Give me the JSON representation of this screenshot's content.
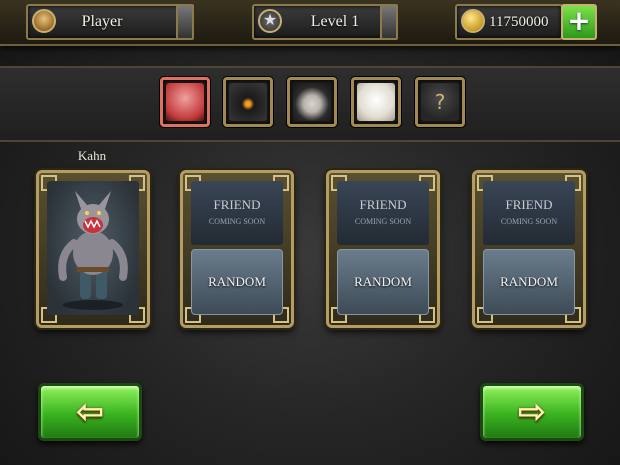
{
  "hud": {
    "player_name": "Player",
    "level_label": "Level 1",
    "coins": "11750000",
    "add_icon": "plus-icon"
  },
  "roster": {
    "portraits": [
      {
        "name": "werewolf-portrait",
        "color": "#d84a4a"
      },
      {
        "name": "pumpkin-portrait",
        "color": "#2a2a2a"
      },
      {
        "name": "vampire-portrait",
        "color": "#b8b4ad"
      },
      {
        "name": "yeti-portrait",
        "color": "#ece9e2"
      },
      {
        "name": "locked-portrait",
        "icon": "question-mark-icon",
        "text": "?"
      }
    ]
  },
  "selected_character": {
    "name": "Kahn"
  },
  "friend_slots": [
    {
      "title": "FRIEND",
      "subtitle": "COMING SOON",
      "random_label": "RANDOM"
    },
    {
      "title": "FRIEND",
      "subtitle": "COMING SOON",
      "random_label": "RANDOM"
    },
    {
      "title": "FRIEND",
      "subtitle": "COMING SOON",
      "random_label": "RANDOM"
    }
  ],
  "navigation": {
    "back_icon": "arrow-left-icon",
    "back_glyph": "⇦",
    "next_icon": "arrow-right-icon",
    "next_glyph": "⇨"
  }
}
